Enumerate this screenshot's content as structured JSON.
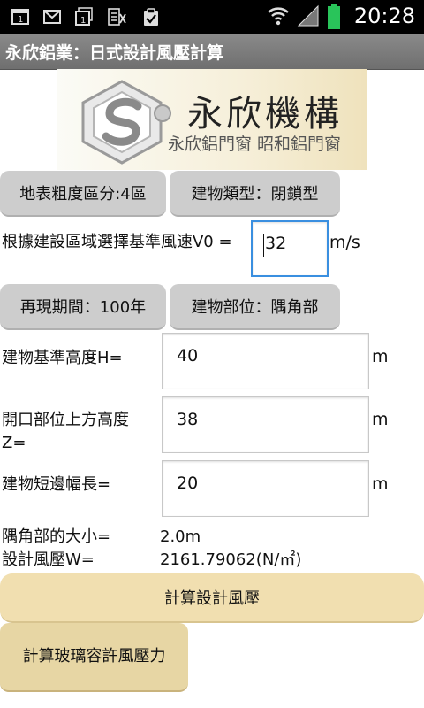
{
  "status_bar": {
    "time": "20:28",
    "icons": [
      "notification-1-icon",
      "gmail-icon",
      "notification-1b-icon",
      "translate-icon",
      "clipboard-check-icon",
      "wifi-icon",
      "signal-icon",
      "battery-icon"
    ]
  },
  "title_bar": {
    "title": "永欣鋁業：日式設計風壓計算"
  },
  "logo": {
    "name": "永欣機構",
    "subtitle": "永欣鋁門窗 昭和鋁門窗"
  },
  "buttons": {
    "roughness": "地表粗度區分:4區",
    "building_type": "建物類型：閉鎖型",
    "return_period": "再現期間：100年",
    "building_part": "建物部位：隅角部",
    "calc_pressure": "計算設計風壓",
    "calc_glass": "計算玻璃容許風壓力"
  },
  "form": {
    "wind_speed": {
      "label": "根據建設區域選擇基準風速V0 =",
      "value": "32",
      "unit": "m/s"
    },
    "height_H": {
      "label": "建物基準高度H=",
      "value": "40",
      "unit": "m"
    },
    "opening_Z": {
      "label": "開口部位上方高度Z=",
      "value": "38",
      "unit": "m"
    },
    "short_side": {
      "label": "建物短邊幅長=",
      "value": "20",
      "unit": "m"
    }
  },
  "results": {
    "corner_size": {
      "label": "隅角部的大小=",
      "value": "2.0m"
    },
    "design_pressure": {
      "label": "設計風壓W=",
      "value": "2161.79062(N/㎡)"
    }
  },
  "colors": {
    "status_bar": "#000000",
    "title_bar": "#7c7c7c",
    "pill": "#cdcdcd",
    "calc_button": "#f1dfb0",
    "glass_button": "#e7d6a4",
    "focus_border": "#3a8fe0",
    "battery": "#29c45a"
  }
}
